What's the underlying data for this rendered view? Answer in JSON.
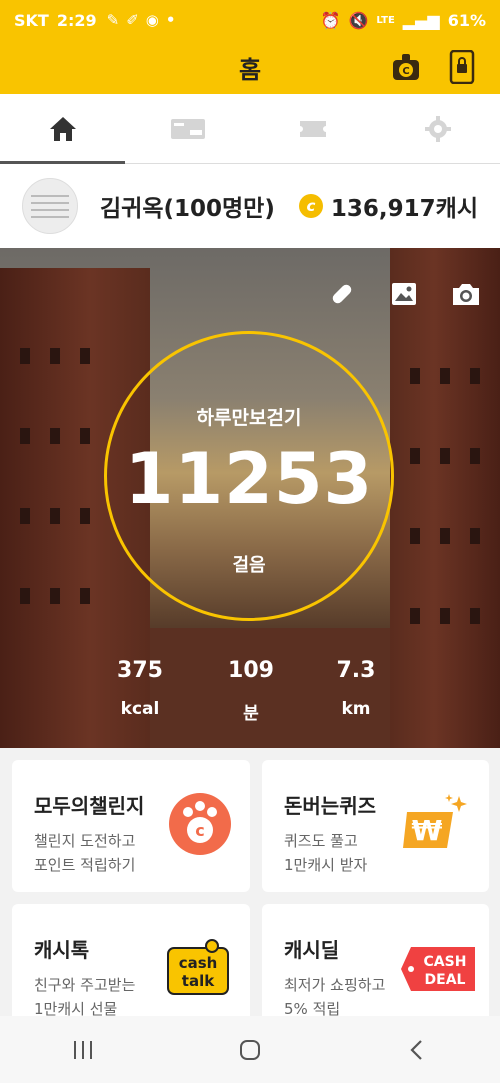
{
  "status_bar": {
    "carrier": "SKT",
    "time": "2:29",
    "battery": "61%",
    "network": "LTE"
  },
  "header": {
    "title": "홈"
  },
  "tabs": [
    {
      "name": "home",
      "icon": "home-icon",
      "active": true
    },
    {
      "name": "cash",
      "icon": "cash-card-icon",
      "active": false
    },
    {
      "name": "ticket",
      "icon": "ticket-icon",
      "active": false
    },
    {
      "name": "settings",
      "icon": "gear-icon",
      "active": false
    }
  ],
  "profile": {
    "name": "김귀옥(100명만)",
    "cash": "136,917캐시",
    "coin_label": "c"
  },
  "walk": {
    "label": "하루만보걷기",
    "steps": "11253",
    "steps_unit": "걸음",
    "stats": [
      {
        "value": "375",
        "unit": "kcal"
      },
      {
        "value": "109",
        "unit": "분"
      },
      {
        "value": "7.3",
        "unit": "km"
      }
    ]
  },
  "cards": [
    {
      "title": "모두의챌린지",
      "line1": "챌린지 도전하고",
      "line2": "포인트 적립하기"
    },
    {
      "title": "돈버는퀴즈",
      "line1": "퀴즈도 풀고",
      "line2": "1만캐시 받자"
    },
    {
      "title": "캐시톡",
      "line1": "친구와 주고받는",
      "line2": "1만캐시 선물"
    },
    {
      "title": "캐시딜",
      "line1": "최저가 쇼핑하고",
      "line2": "5% 적립"
    }
  ],
  "logos": {
    "cashtalk_1": "cash",
    "cashtalk_2": "talk",
    "cashdeal_1": "CASH",
    "cashdeal_2": "DEAL"
  },
  "colors": {
    "brand_yellow": "#f9c400",
    "ring": "#f9c400",
    "challenge_orange": "#f26b4a",
    "quiz_orange": "#f5a623",
    "deal_red": "#f04141"
  }
}
